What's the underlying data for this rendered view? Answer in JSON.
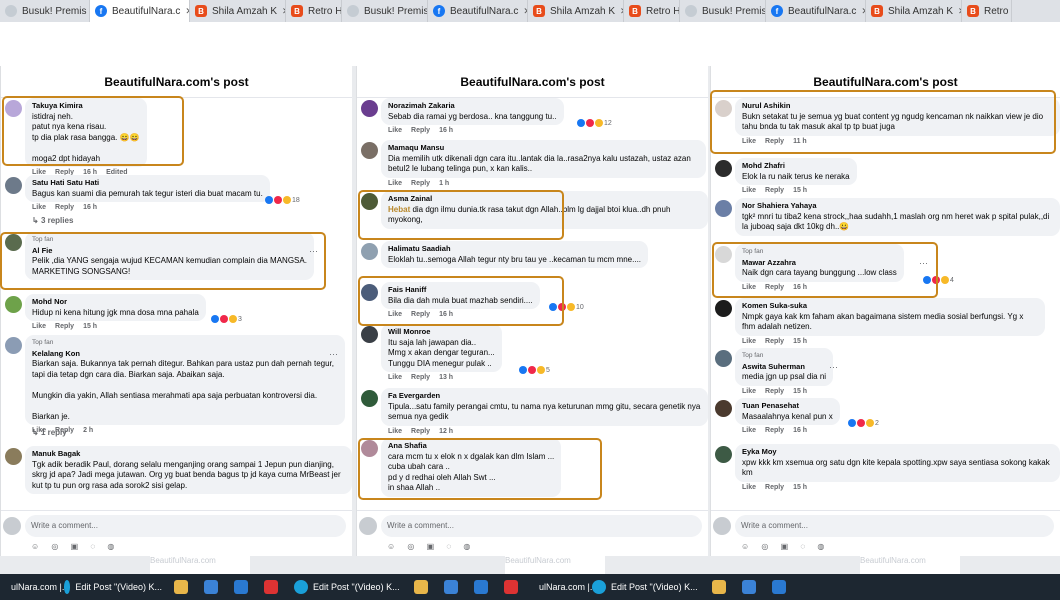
{
  "tabs": [
    {
      "label": "Busuk! Premis",
      "icon": "google-drive-icon"
    },
    {
      "label": "BeautifulNara.c",
      "icon": "facebook-icon",
      "active": true
    },
    {
      "label": "Shila Amzah K",
      "icon": "blogger-icon"
    },
    {
      "label": "Retro Ha",
      "icon": "blogger-icon"
    },
    {
      "label": "Busuk! Premis",
      "icon": "google-drive-icon"
    },
    {
      "label": "BeautifulNara.c",
      "icon": "facebook-icon"
    },
    {
      "label": "Shila Amzah K",
      "icon": "blogger-icon"
    },
    {
      "label": "Retro H",
      "icon": "blogger-icon"
    },
    {
      "label": "Busuk! Premis",
      "icon": "google-drive-icon"
    },
    {
      "label": "BeautifulNara.c",
      "icon": "facebook-icon"
    },
    {
      "label": "Shila Amzah K",
      "icon": "blogger-icon"
    },
    {
      "label": "Retro H",
      "icon": "blogger-icon"
    }
  ],
  "write_comment": "Write a comment...",
  "panels": [
    {
      "title": "BeautifulNara.com's post",
      "comments": [
        {
          "name": "Takuya Kimira",
          "text": "istidraj neh.\npatut nya kena risau.\ntp dia plak rasa bangga. 😄😄\n\nmoga2 dpt hidayah",
          "actions": [
            "Like",
            "Reply",
            "16 h",
            "Edited"
          ],
          "avatar": "#b8a7d9"
        },
        {
          "name": "Satu Hati Satu Hati",
          "text": "Bagus kan suami dia pemurah tak tegur isteri dia buat macam tu.",
          "actions": [
            "Like",
            "Reply",
            "16 h"
          ],
          "reactions": "18",
          "avatar": "#6d7a8a"
        },
        {
          "replies": "3 replies"
        },
        {
          "top_fan": "Top fan",
          "name": "Al Fie",
          "text": "Pelik ,dia YANG sengaja wujud KECAMAN kemudian complain dia MANGSA.\nMARKETING SONGSANG!",
          "avatar": "#5a6b4e"
        },
        {
          "name": "Mohd Nor",
          "text": "Hidup ni kena hitung jgk mna dosa mna pahala",
          "actions": [
            "Like",
            "Reply",
            "15 h"
          ],
          "reactions": "3",
          "avatar": "#6ea24a"
        },
        {
          "top_fan": "Top fan",
          "name": "Kelalang Kon",
          "text": "Biarkan saja. Bukannya tak pernah ditegur. Bahkan para ustaz pun dah pernah tegur, tapi dia tetap dgn cara dia. Biarkan saja. Abaikan saja.\n\nMungkin dia yakin, Allah sentiasa merahmati apa saja perbuatan kontroversi dia.\n\nBiarkan je.",
          "actions": [
            "Like",
            "Reply",
            "2 h"
          ],
          "avatar": "#8b9cb4"
        },
        {
          "replies": "1 reply"
        },
        {
          "name": "Manuk Bagak",
          "text": "Tgk adik beradik Paul, dorang selalu menganjing orang sampai 1 Jepun pun dianjing, skrg jd apa? Jadi mega jutawan. Org yg buat benda bagus tp jd kaya cuma MrBeast jer kut tp tu pun org rasa ada sorok2 sisi gelap.",
          "avatar": "#8a7c5c"
        }
      ]
    },
    {
      "title": "BeautifulNara.com's post",
      "comments": [
        {
          "name": "Norazimah Zakaria",
          "text": "Sebab dia ramai yg berdosa.. kna tanggung tu..",
          "actions": [
            "Like",
            "Reply",
            "16 h"
          ],
          "reactions": "12",
          "avatar": "#6a3d8f"
        },
        {
          "name": "Mamaqu Mansu",
          "text": "Dia memilih utk dikenali dgn cara itu..lantak dia la..rasa2nya kalu ustazah, ustaz azan betul2 le lubang telinga pun, x kan kalis..",
          "actions": [
            "Like",
            "Reply",
            "1 h"
          ],
          "avatar": "#7a6f66"
        },
        {
          "name": "Asma Zainal",
          "highlight": "Hebat",
          "text": " dia dgn ilmu dunia.tk rasa takut dgn Allah..blm lg dajjal btoi klua..dh pnuh myokong,",
          "avatar": "#4e5b37"
        },
        {
          "name": "Halimatu Saadiah",
          "text": "Eloklah tu..semoga Allah tegur nty bru tau ye ..kecaman tu mcm mne....",
          "avatar": "#8fa0b0"
        },
        {
          "name": "Fais Haniff",
          "text": "Bila dia dah mula buat mazhab sendiri....",
          "actions": [
            "Like",
            "Reply",
            "16 h"
          ],
          "reactions": "10",
          "avatar": "#4c5d7a"
        },
        {
          "name": "Will Monroe",
          "text": "Itu saja lah jawapan dia..\nMmg x akan dengar teguran...\nTunggu DIA menegur pulak ..",
          "actions": [
            "Like",
            "Reply",
            "13 h"
          ],
          "reactions": "5",
          "avatar": "#3a3f46"
        },
        {
          "name": "Fa Evergarden",
          "text": "Tipula...satu family perangai cmtu, tu nama nya keturunan mmg gitu, secara genetik nya semua nya gedik",
          "actions": [
            "Like",
            "Reply",
            "12 h"
          ],
          "avatar": "#2f5b3a"
        },
        {
          "name": "Ana Shafia",
          "text": "cara mcm tu x elok n x dgalak kan dlm Islam ...\ncuba ubah cara ..\npd y d redhai oleh Allah Swt ...\nin shaa Allah ..",
          "avatar": "#b08a9a"
        }
      ]
    },
    {
      "title": "BeautifulNara.com's post",
      "comments": [
        {
          "name": "Nurul Ashikin",
          "text": "Bukn setakat tu je semua yg buat content yg ngudg kencaman nk naikkan view je dio tahu bnda tu tak masuk akal tp tp buat juga",
          "actions": [
            "Like",
            "Reply",
            "11 h"
          ],
          "avatar": "#d9d0cb"
        },
        {
          "name": "Mohd Zhafri",
          "text": "Elok la ru naik terus ke neraka",
          "actions": [
            "Like",
            "Reply",
            "15 h"
          ],
          "avatar": "#2b2b2b"
        },
        {
          "name": "Nor Shahiera Yahaya",
          "text": "tgk² mnri tu tiba2 kena strock,,haa sudahh,1 maslah org nm heret wak p spital pulak,,di la juboaq saja dkt 10kg dh..😀",
          "avatar": "#6b7fa6"
        },
        {
          "top_fan": "Top fan",
          "name": "Mawar Azzahra",
          "text": "Naik dgn cara tayang bunggung ...low class",
          "actions": [
            "Like",
            "Reply",
            "16 h"
          ],
          "reactions": "4",
          "avatar": "#d8d8d8"
        },
        {
          "name": "Komen Suka-suka",
          "text": "Nmpk gaya kak km faham akan bagaimana sistem media sosial berfungsi. Yg x fhm adalah netizen.",
          "actions": [
            "Like",
            "Reply",
            "15 h"
          ],
          "avatar": "#1c1c1c"
        },
        {
          "top_fan": "Top fan",
          "name": "Aswita Suherman",
          "text": "media jgn up psal dia ni",
          "actions": [
            "Like",
            "Reply",
            "15 h"
          ],
          "avatar": "#5a6e7e"
        },
        {
          "name": "Tuan Penasehat",
          "text": "Masaalahnya kenal pun x",
          "actions": [
            "Like",
            "Reply",
            "16 h"
          ],
          "reactions": "2",
          "avatar": "#4b3a2e"
        },
        {
          "name": "Eyka Moy",
          "text": "xpw kkk km xsemua org satu dgn kite kepala spotting.xpw saya sentiasa sokong kakak km",
          "actions": [
            "Like",
            "Reply",
            "15 h"
          ],
          "avatar": "#3d5a45"
        }
      ]
    }
  ],
  "taskbar": [
    {
      "label": "ulNara.com |...",
      "icon": "chrome-icon"
    },
    {
      "label": "Edit Post \"(Video) K...",
      "icon": "edge-icon"
    },
    {
      "label": "",
      "icon": "folder-icon"
    },
    {
      "label": "",
      "icon": "store-icon"
    },
    {
      "label": "",
      "icon": "mail-icon"
    },
    {
      "label": "",
      "icon": "wps-icon"
    },
    {
      "label": "Edit Post \"(Video) K...",
      "icon": "edge-icon"
    },
    {
      "label": "",
      "icon": "folder-icon"
    },
    {
      "label": "",
      "icon": "store-icon"
    },
    {
      "label": "",
      "icon": "mail-icon"
    },
    {
      "label": "",
      "icon": "wps-icon"
    },
    {
      "label": "ulNara.com |...",
      "icon": "chrome-icon"
    },
    {
      "label": "Edit Post \"(Video) K...",
      "icon": "edge-icon"
    },
    {
      "label": "",
      "icon": "folder-icon"
    },
    {
      "label": "",
      "icon": "store-icon"
    },
    {
      "label": "",
      "icon": "mail-icon"
    }
  ],
  "ghost": "BeautifulNara.com"
}
